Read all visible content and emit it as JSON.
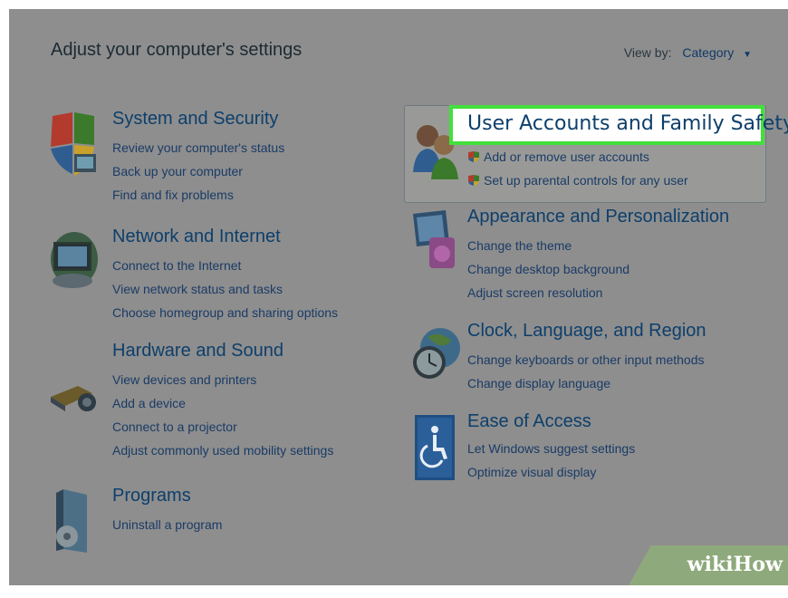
{
  "page": {
    "title": "Adjust your computer's settings",
    "view_by_label": "View by:",
    "view_by_value": "Category"
  },
  "categories_left": [
    {
      "title": "System and Security",
      "icon": "shield-icon",
      "links": [
        "Review your computer's status",
        "Back up your computer",
        "Find and fix problems"
      ]
    },
    {
      "title": "Network and Internet",
      "icon": "network-icon",
      "links": [
        "Connect to the Internet",
        "View network status and tasks",
        "Choose homegroup and sharing options"
      ]
    },
    {
      "title": "Hardware and Sound",
      "icon": "printer-icon",
      "links": [
        "View devices and printers",
        "Add a device",
        "Connect to a projector",
        "Adjust commonly used mobility settings"
      ]
    },
    {
      "title": "Programs",
      "icon": "programs-icon",
      "links": [
        "Uninstall a program"
      ]
    }
  ],
  "user_accounts": {
    "title": "User Accounts and Family Safety",
    "icon": "users-icon",
    "links": [
      "Add or remove user accounts",
      "Set up parental controls for any user"
    ],
    "highlight_color": "#43e03b"
  },
  "categories_right": [
    {
      "title": "Appearance and Personalization",
      "icon": "monitor-paint-icon",
      "links": [
        "Change the theme",
        "Change desktop background",
        "Adjust screen resolution"
      ]
    },
    {
      "title": "Clock, Language, and Region",
      "icon": "clock-globe-icon",
      "links": [
        "Change keyboards or other input methods",
        "Change display language"
      ]
    },
    {
      "title": "Ease of Access",
      "icon": "accessibility-icon",
      "links": [
        "Let Windows suggest settings",
        "Optimize visual display"
      ]
    }
  ],
  "watermark": {
    "text": "wikiHow"
  }
}
